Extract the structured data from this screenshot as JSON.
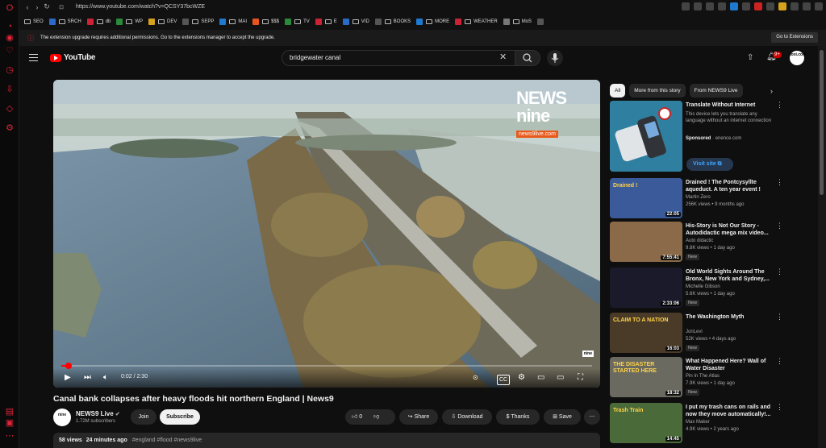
{
  "browser": {
    "url": "https://www.youtube.com/watch?v=QCSY37bcWZE",
    "bookmarks": [
      "SEO",
      "SRCH",
      "db",
      "WP",
      "DEV",
      "SEPP",
      "MAI",
      "$$$",
      "TV",
      "E",
      "VID",
      "BOOKS",
      "MORE",
      "WEATHER",
      "MoS"
    ],
    "notice": "The extension upgrade requires additional permissions. Go to the extensions manager to accept the upgrade.",
    "notice_button": "Go to Extensions"
  },
  "header": {
    "logo": "YouTube",
    "search_value": "bridgewater canal",
    "notif_count": "9+",
    "avatar_text": "toxi.com"
  },
  "player": {
    "time": "0:02 / 2:30",
    "progress": 0.013,
    "logo_line1": "NEWS",
    "logo_line2": "nine",
    "logo_url": "news9live.com",
    "watermark": "nine"
  },
  "video": {
    "title": "Canal bank collapses after heavy floods hit northern England | News9",
    "channel": "NEWS9 Live",
    "subscribers": "1.72M subscribers",
    "channel_avatar": "nine",
    "join": "Join",
    "subscribe": "Subscribe",
    "likes": "0",
    "share": "Share",
    "download": "Download",
    "thanks": "Thanks",
    "save": "Save",
    "views": "58 views",
    "ago": "24 minutes ago",
    "tags": "#england #flood #news9live"
  },
  "chips": [
    "All",
    "More from this story",
    "From NEWS9 Live"
  ],
  "ad": {
    "title": "Translate Without Internet",
    "desc": "This device lets you translate any language without an internet connection",
    "sponsored": "Sponsored",
    "domain": "enence.com",
    "visit": "Visit site"
  },
  "recs": [
    {
      "title": "Drained ! The Pontcysyllte aqueduct. A ten year event !",
      "channel": "Martin Zero",
      "meta": "256K views • 9 months ago",
      "duration": "22:05",
      "new": "",
      "thumb_text": "Drained !",
      "color": "#3a5a9a"
    },
    {
      "title": "His-Story is Not Our Story - Autodidactic mega mix video...",
      "channel": "Auto didactic",
      "meta": "9.8K views • 1 day ago",
      "duration": "7:55:41",
      "new": "New",
      "thumb_text": "",
      "color": "#8a6a48"
    },
    {
      "title": "Old World Sights Around The Bronx, New York and Sydney,...",
      "channel": "Michelle Gibson",
      "meta": "5.6K views • 1 day ago",
      "duration": "2:33:06",
      "new": "New",
      "thumb_text": "",
      "color": "#1a1a2a"
    },
    {
      "title": "The Washington Myth",
      "channel": "JonLevi",
      "meta": "52K views • 4 days ago",
      "duration": "16:03",
      "new": "New",
      "thumb_text": "CLAIM TO A NATION",
      "color": "#4a3a28"
    },
    {
      "title": "What Happened Here? Wall of Water Disaster",
      "channel": "Pin In The Atlas",
      "meta": "7.9K views • 1 day ago",
      "duration": "18:32",
      "new": "New",
      "thumb_text": "THE DISASTER STARTED HERE",
      "color": "#6a6a60"
    },
    {
      "title": "I put my trash cans on rails and now they move automatically!...",
      "channel": "Max Maker",
      "meta": "4.9K views • 2 years ago",
      "duration": "14:45",
      "new": "",
      "thumb_text": "Trash Train",
      "color": "#4a6a3a"
    }
  ]
}
